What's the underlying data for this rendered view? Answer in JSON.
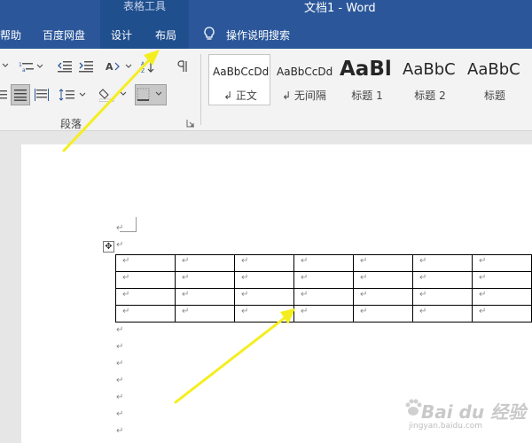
{
  "title_bar": {
    "tools_label": "表格工具",
    "document_title": "文档1  -  Word"
  },
  "tabs": {
    "help": "帮助",
    "baidu": "百度网盘",
    "design": "设计",
    "layout": "布局",
    "search": "操作说明搜索"
  },
  "ribbon": {
    "paragraph_group_label": "段落",
    "styles": [
      {
        "sample": "AaBbCcDd",
        "name": "↲ 正文",
        "selected": true
      },
      {
        "sample": "AaBbCcDd",
        "name": "↲ 无间隔",
        "selected": false
      },
      {
        "sample": "AaBl",
        "name": "标题 1",
        "selected": false
      },
      {
        "sample": "AaBbC",
        "name": "标题 2",
        "selected": false
      },
      {
        "sample": "AaBbC",
        "name": "标题",
        "selected": false
      }
    ]
  },
  "document": {
    "paragraph_mark": "↵",
    "table": {
      "rows": 4,
      "cols": 7
    }
  },
  "colors": {
    "titlebar": "#2b579a",
    "context_band": "#204f8e",
    "arrow": "#f5ee1e"
  },
  "watermark": {
    "main": "Bai du 经验",
    "sub": "jingyan.baidu.com"
  }
}
